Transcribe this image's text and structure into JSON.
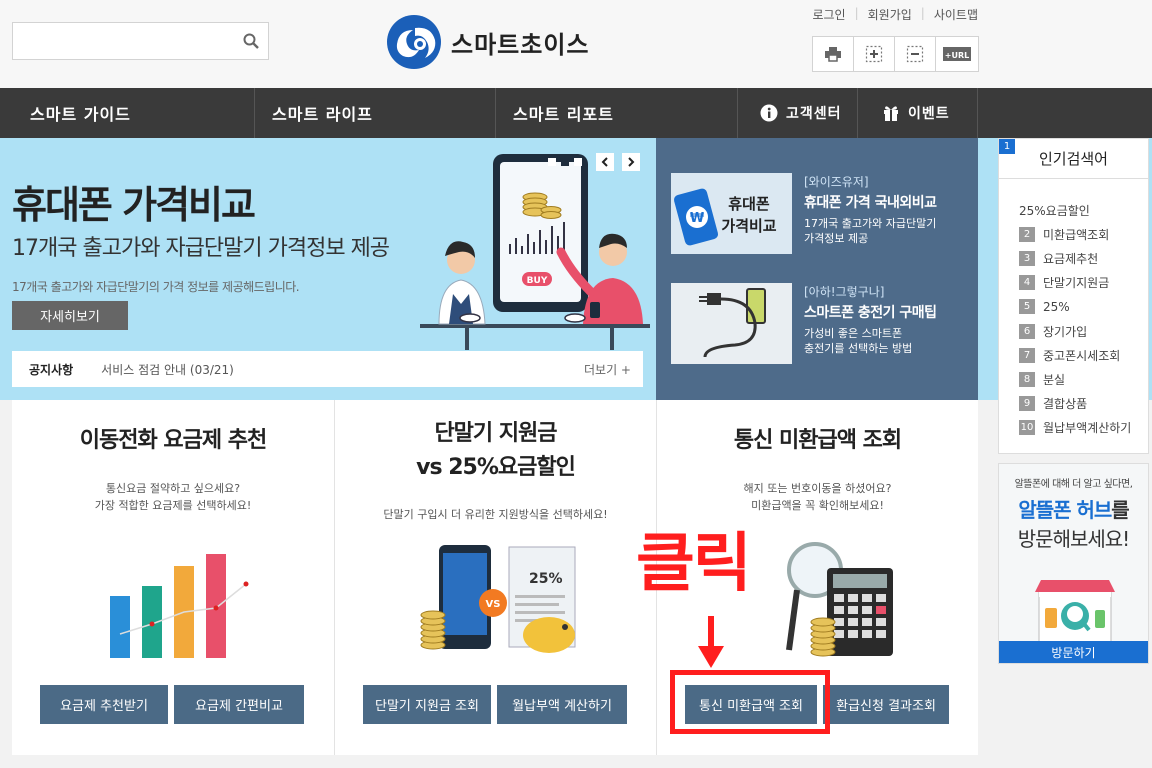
{
  "header": {
    "search_placeholder": "",
    "brand": "스마트초이스",
    "util_links": [
      "로그인",
      "회원가입",
      "사이트맵"
    ],
    "tools": [
      "print-icon",
      "zoom-in-icon",
      "zoom-out-icon",
      "url-icon"
    ],
    "url_label": "+URL"
  },
  "nav": {
    "items": [
      "스마트 가이드",
      "스마트 라이프",
      "스마트 리포트"
    ],
    "support": "고객센터",
    "event": "이벤트"
  },
  "banner": {
    "title": "휴대폰 가격비교",
    "subtitle": "17개국 출고가와 자급단말기 가격정보 제공",
    "desc": "17개국 출고가와 자급단말기의 가격 정보를 제공해드립니다.",
    "detail_button": "자세히보기",
    "buy_label": "BUY"
  },
  "notice": {
    "label": "공지사항",
    "text": "서비스 점검 안내 (03/21)",
    "more": "더보기 +"
  },
  "news": [
    {
      "tag": "[와이즈유저]",
      "title": "휴대폰 가격 국내외비교",
      "desc_line1": "17개국 출고가와 자급단말기",
      "desc_line2": "가격정보 제공",
      "thumb_line1": "휴대폰",
      "thumb_line2": "가격비교",
      "won": "₩"
    },
    {
      "tag": "[아하!그렇구나]",
      "title": "스마트폰 충전기 구매팁",
      "desc_line1": "가성비 좋은 스마트폰",
      "desc_line2": "충전기를 선택하는 방법"
    }
  ],
  "popular": {
    "title": "인기검색어",
    "items": [
      {
        "num": "1",
        "label": "25%요금할인"
      },
      {
        "num": "2",
        "label": "미환급액조회"
      },
      {
        "num": "3",
        "label": "요금제추천"
      },
      {
        "num": "4",
        "label": "단말기지원금"
      },
      {
        "num": "5",
        "label": "25%"
      },
      {
        "num": "6",
        "label": "장기가입"
      },
      {
        "num": "7",
        "label": "중고폰시세조회"
      },
      {
        "num": "8",
        "label": "분실"
      },
      {
        "num": "9",
        "label": "결합상품"
      },
      {
        "num": "10",
        "label": "월납부액계산하기"
      }
    ]
  },
  "ad": {
    "line1": "알뜰폰에 대해 더 알고 싶다면,",
    "line2_blue": "알뜰폰 허브",
    "line2_rest": "를",
    "line3": "방문해보세요!",
    "button": "방문하기"
  },
  "cards": [
    {
      "title": "이동전화 요금제 추천",
      "desc_line1": "통신요금 절약하고 싶으세요?",
      "desc_line2": "가장 적합한 요금제를 선택하세요!",
      "btn1": "요금제 추천받기",
      "btn2": "요금제 간편비교"
    },
    {
      "title_line1": "단말기 지원금",
      "title_line2": "vs 25%요금할인",
      "desc_line1": "단말기 구입시 더 유리한 지원방식을 선택하세요!",
      "btn1": "단말기 지원금 조회",
      "btn2": "월납부액 계산하기",
      "vs": "VS",
      "pct": "25%"
    },
    {
      "title": "통신 미환급액 조회",
      "desc_line1": "해지 또는 번호이동을 하셨어요?",
      "desc_line2": "미환급액을 꼭 확인해보세요!",
      "btn1": "통신 미환급액 조회",
      "btn2": "환급신청 결과조회"
    }
  ],
  "annotation": {
    "text": "클릭",
    "color": "#ff1e1e"
  },
  "colors": {
    "nav_bg": "#3a3a3a",
    "banner_bg": "#aee1f5",
    "news_bg": "#4e6b8a",
    "button_bg": "#4b6a86",
    "accent_blue": "#1a6fd1"
  }
}
